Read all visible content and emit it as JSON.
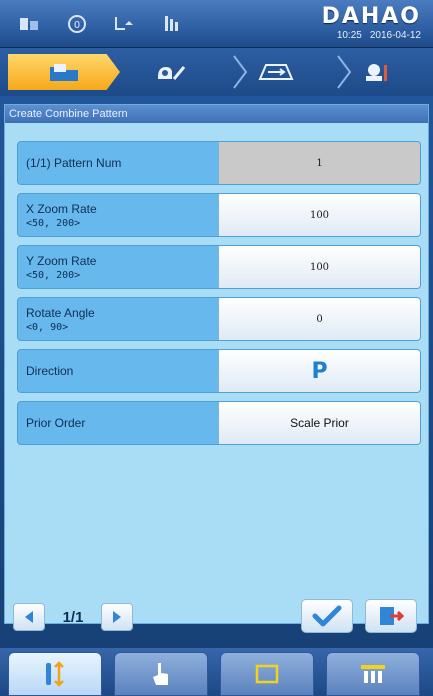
{
  "header": {
    "brand": "DAHAO",
    "time": "10:25",
    "date": "2016-04-12",
    "status_icons": [
      "stitch-counter-icon",
      "speed-icon",
      "thread-icon",
      "needle-icon"
    ]
  },
  "nav": {
    "tabs": [
      {
        "icon": "folder-icon",
        "active": true
      },
      {
        "icon": "edit-pattern-icon",
        "active": false
      },
      {
        "icon": "frame-move-icon",
        "active": false
      },
      {
        "icon": "machine-settings-icon",
        "active": false
      }
    ]
  },
  "panel": {
    "title": "Create Combine Pattern",
    "rows": [
      {
        "label": "(1/1) Pattern Num",
        "range": "",
        "value": "1"
      },
      {
        "label": "X Zoom Rate",
        "range": "<50, 200>",
        "value": "100"
      },
      {
        "label": "Y Zoom Rate",
        "range": "<50, 200>",
        "value": "100"
      },
      {
        "label": "Rotate Angle",
        "range": "<0, 90>",
        "value": "0"
      },
      {
        "label": "Direction",
        "range": "",
        "value": "P"
      },
      {
        "label": "Prior Order",
        "range": "",
        "value": "Scale Prior"
      }
    ],
    "page_indicator": "1/1"
  },
  "colors": {
    "panel_bg": "#a9ddf6",
    "row_bg": "#67b8ec",
    "active_tab": "#f6a81a",
    "accent_blue": "#1e7ed0"
  }
}
